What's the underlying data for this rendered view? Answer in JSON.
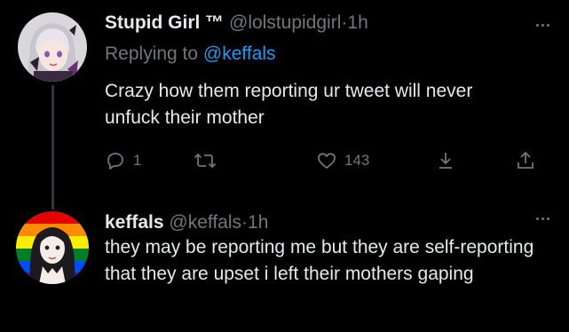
{
  "tweets": [
    {
      "display_name": "Stupid Girl ™",
      "handle": "@lolstupidgirl",
      "dot": "·",
      "time": "1h",
      "replying_prefix": "Replying to",
      "replying_to": "@keffals",
      "text": "Crazy how them reporting ur tweet will never unfuck their mother",
      "actions": {
        "reply_count": "1",
        "like_count": "143"
      },
      "icons": [
        "reply-icon",
        "retweet-icon",
        "heart-icon",
        "download-icon",
        "share-icon",
        "more-icon"
      ]
    },
    {
      "display_name": "keffals",
      "handle": "@keffals",
      "dot": "·",
      "time": "1h",
      "text": "they may be reporting me but they are self-reporting that they are upset i left their mothers gaping",
      "icons": [
        "more-icon"
      ]
    }
  ],
  "colors": {
    "background": "#000000",
    "primary_text": "#e7e9ea",
    "secondary_text": "#71767b",
    "link": "#1d9bf0",
    "thread_line": "#333639"
  }
}
